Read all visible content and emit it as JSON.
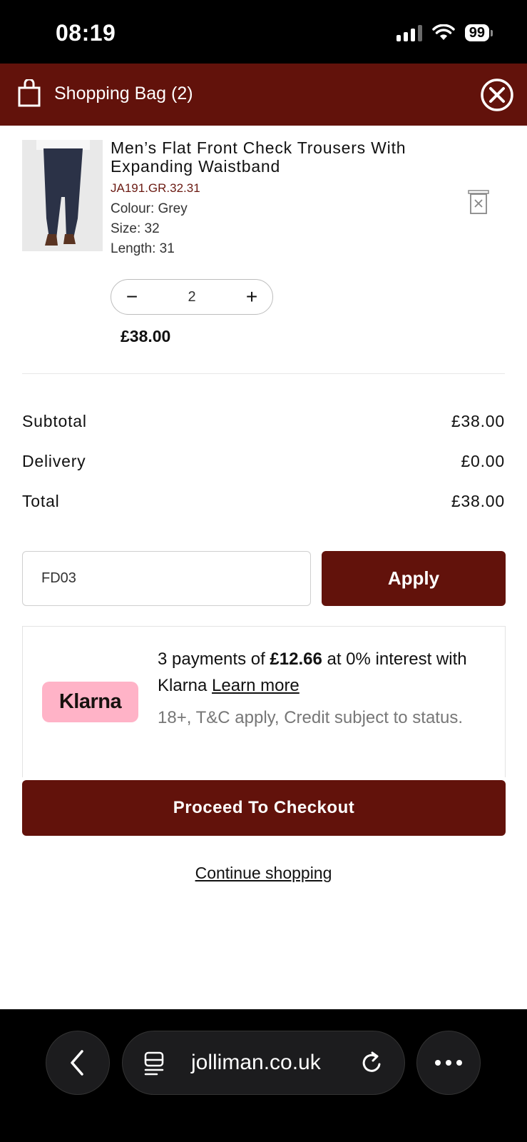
{
  "status_bar": {
    "time": "08:19",
    "battery": "99"
  },
  "header": {
    "title": "Shopping Bag (2)"
  },
  "cart": {
    "item": {
      "title": "Men’s Flat Front Check Trousers With Expanding Waistband",
      "sku": "JA191.GR.32.31",
      "colour": "Colour: Grey",
      "size": "Size: 32",
      "length": "Length: 31",
      "quantity": "2",
      "minus": "−",
      "plus": "+",
      "price": "£38.00"
    }
  },
  "summary": {
    "subtotal_label": "Subtotal",
    "subtotal_value": "£38.00",
    "delivery_label": "Delivery",
    "delivery_value": "£0.00",
    "total_label": "Total",
    "total_value": "£38.00"
  },
  "promo": {
    "value": "FD03",
    "apply_label": "Apply"
  },
  "klarna": {
    "logo": "Klarna",
    "text_prefix": "3 payments of ",
    "amount": "£12.66",
    "text_suffix": " at 0% interest with Klarna ",
    "link": "Learn more",
    "note": "18+, T&C apply, Credit subject to status."
  },
  "checkout_label": "Proceed To Checkout",
  "continue_label": "Continue shopping",
  "browser": {
    "url": "jolliman.co.uk"
  },
  "colors": {
    "brand": "#62120b",
    "klarna_pink": "#ffb3c7"
  }
}
